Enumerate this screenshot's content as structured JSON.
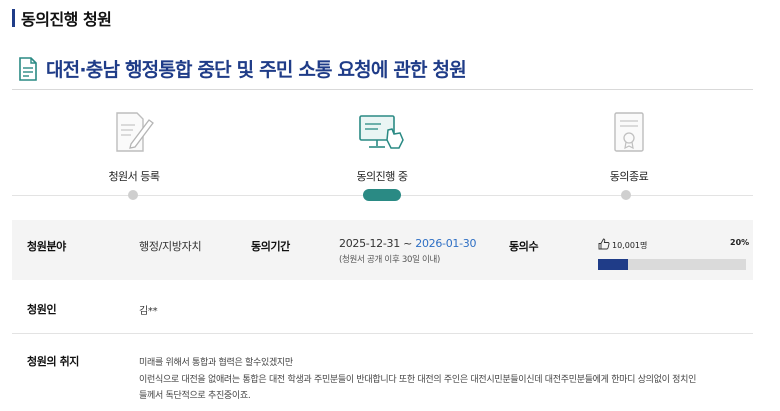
{
  "page": {
    "heading": "동의진행 청원",
    "petition_title": "대전·충남 행정통합 중단 및 주민 소통 요청에 관한 청원"
  },
  "steps": [
    {
      "label": "청원서 등록",
      "icon": "pen-document-icon",
      "state": "done"
    },
    {
      "label": "동의진행 중",
      "icon": "monitor-hand-icon",
      "state": "active"
    },
    {
      "label": "동의종료",
      "icon": "certificate-icon",
      "state": "pending"
    }
  ],
  "info": {
    "field_label": "청원분야",
    "field_value": "행정/지방자치",
    "period_label": "동의기간",
    "period_start": "2025-12-31",
    "period_separator": "~",
    "period_end": "2026-01-30",
    "period_note": "(청원서 공개 이후 30일 이내)",
    "consent_label": "동의수",
    "consent_count": "10,001명",
    "consent_percent_text": "20%",
    "consent_progress": 0.2,
    "petitioner_label": "청원인",
    "petitioner_value": "김**",
    "purpose_label": "청원의 취지",
    "purpose_lines": [
      "미래를 위해서 통합과 협력은 할수있겠지만",
      "이런식으로 대전을 없애려는 통합은 대전 학생과 주민분들이 반대합니다 또한 대전의 주인은 대전시민분들이신데 대전주민분들에게 한마디 상의없이 정치인",
      "들께서 독단적으로 추진중이죠."
    ]
  },
  "colors": {
    "brand": "#1f3c88",
    "accent_teal": "#2a8a84",
    "link_blue": "#2e6fc4"
  }
}
